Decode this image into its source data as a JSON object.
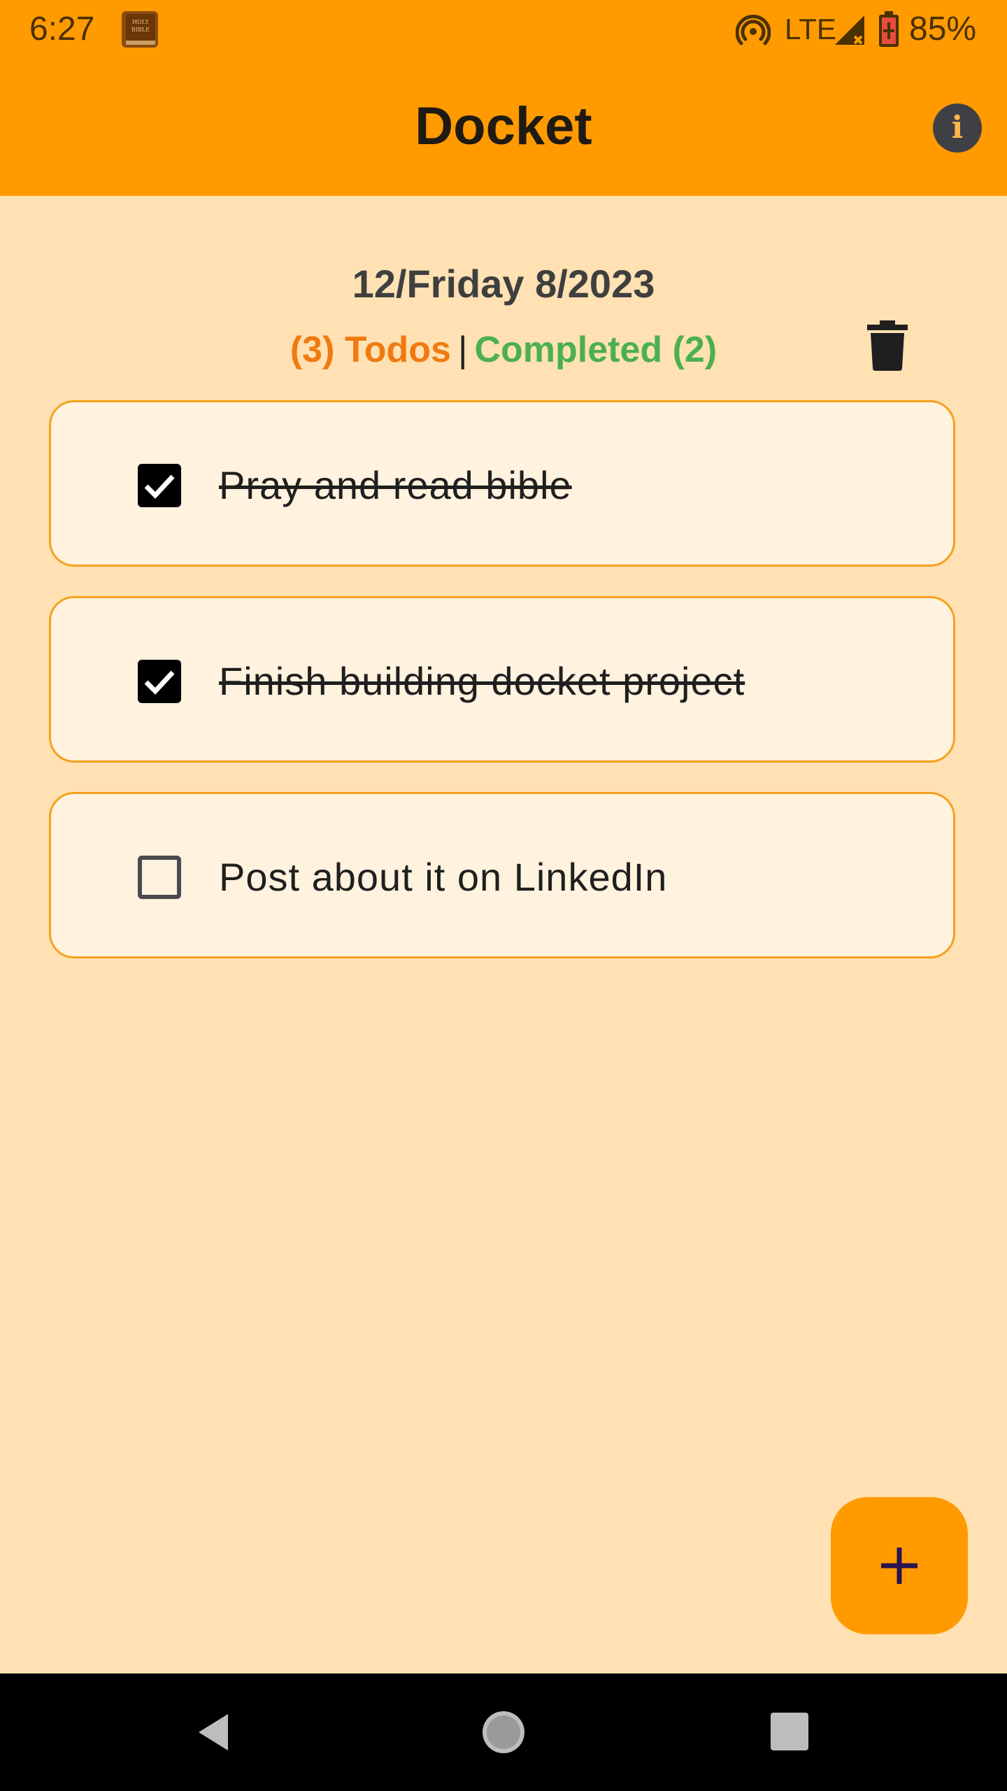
{
  "status_bar": {
    "time": "6:27",
    "network": "LTE",
    "battery": "85%",
    "icons": [
      "holy-bible-app-icon",
      "hotspot-icon",
      "signal-icon",
      "battery-charging-icon"
    ]
  },
  "app_bar": {
    "title": "Docket",
    "info_icon": "i"
  },
  "date": "12/Friday 8/2023",
  "summary": {
    "todos": "(3) Todos",
    "separator": "|",
    "completed": "Completed (2)"
  },
  "todos": [
    {
      "text": "Pray and read bible",
      "checked": true
    },
    {
      "text": "Finish building docket project",
      "checked": true
    },
    {
      "text": "Post about it on LinkedIn",
      "checked": false
    }
  ],
  "fab": {
    "icon": "plus-icon"
  },
  "colors": {
    "primary": "#FF9B00",
    "background": "#FFE1B3",
    "card": "#FFF2DE",
    "card_border": "#F5A11E",
    "todos_accent": "#F07A12",
    "completed_accent": "#4CAF50"
  }
}
